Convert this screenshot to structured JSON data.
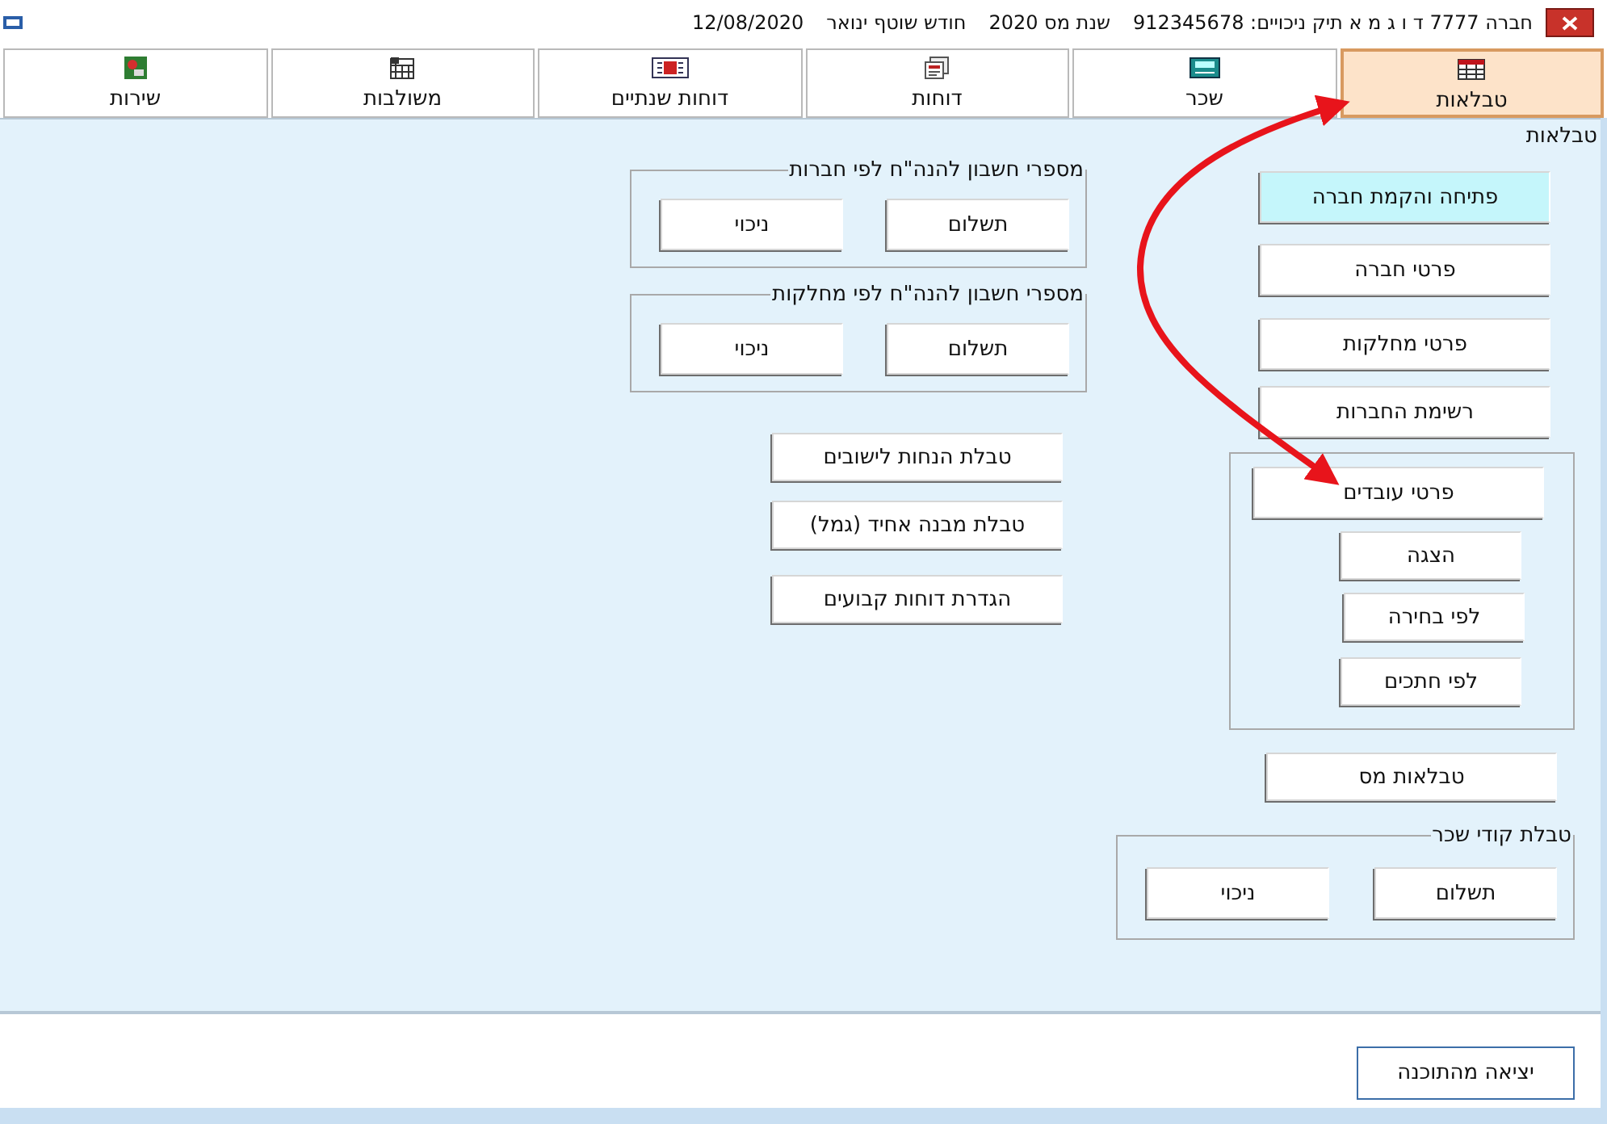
{
  "window": {
    "title_parts": [
      "חברה 7777 ד ו ג מ א תיק ניכויים: 912345678",
      "שנת מס 2020",
      "חודש שוטף ינואר",
      "12/08/2020"
    ]
  },
  "tabs": [
    {
      "label": "טבלאות",
      "selected": true
    },
    {
      "label": "שכר",
      "selected": false
    },
    {
      "label": "דוחות",
      "selected": false
    },
    {
      "label": "דוחות שנתיים",
      "selected": false
    },
    {
      "label": "משולבות",
      "selected": false
    },
    {
      "label": "שירות",
      "selected": false
    }
  ],
  "panel_label": "טבלאות",
  "company_buttons": [
    {
      "label": "פתיחה והקמת חברה",
      "highlighted": true
    },
    {
      "label": "פרטי חברה",
      "highlighted": false
    },
    {
      "label": "פרטי מחלקות",
      "highlighted": false
    },
    {
      "label": "רשימת החברות",
      "highlighted": false
    }
  ],
  "employees_group": {
    "button": "פרטי עובדים",
    "sub_buttons": [
      "הצגה",
      "לפי בחירה",
      "לפי חתכים"
    ]
  },
  "tax_tables_button": "טבלאות מס",
  "pay_codes_group": {
    "title": "טבלת קודי שכר",
    "buttons": [
      "תשלום",
      "ניכוי"
    ]
  },
  "account_groups": [
    {
      "title": "מספרי חשבון להנה\"ח לפי חברות",
      "buttons": [
        "תשלום",
        "ניכוי"
      ]
    },
    {
      "title": "מספרי חשבון להנה\"ח לפי מחלקות",
      "buttons": [
        "תשלום",
        "ניכוי"
      ]
    }
  ],
  "table_buttons": [
    "טבלת הנחות לישובים",
    "טבלת מבנה אחיד (גמל)",
    "הגדרת דוחות קבועים"
  ],
  "exit_button": "יציאה מהתוכנה"
}
